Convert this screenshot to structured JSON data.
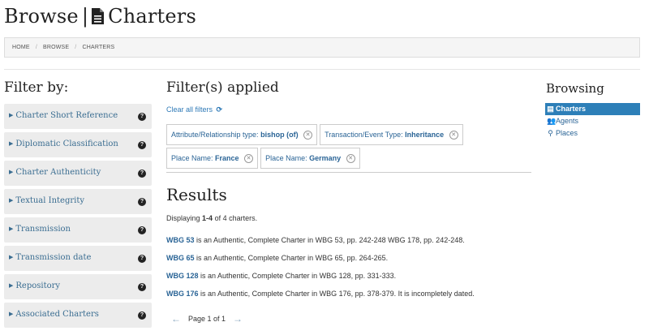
{
  "page": {
    "title_prefix": "Browse",
    "title_separator": "|",
    "title": "Charters"
  },
  "breadcrumb": [
    "HOME",
    "BROWSE",
    "CHARTERS"
  ],
  "filters": {
    "title": "Filter by:",
    "facets": [
      {
        "label": "Charter Short Reference"
      },
      {
        "label": "Diplomatic Classification"
      },
      {
        "label": "Charter Authenticity"
      },
      {
        "label": "Textual Integrity"
      },
      {
        "label": "Transmission"
      },
      {
        "label": "Transmission date"
      },
      {
        "label": "Repository"
      },
      {
        "label": "Associated Charters"
      }
    ],
    "help_glyph": "?"
  },
  "applied": {
    "title": "Filter(s) applied",
    "clear_label": "Clear all filters",
    "chips": [
      {
        "key": "Attribute/Relationship type:",
        "value": "bishop (of)"
      },
      {
        "key": "Transaction/Event Type:",
        "value": "Inheritance"
      },
      {
        "key": "Place Name:",
        "value": "France"
      },
      {
        "key": "Place Name:",
        "value": "Germany"
      }
    ]
  },
  "results": {
    "title": "Results",
    "displaying_prefix": "Displaying",
    "displaying_range": "1-4",
    "displaying_suffix": "of 4 charters.",
    "items": [
      {
        "ref": "WBG 53",
        "text": "is an Authentic, Complete Charter in WBG 53, pp. 242-248 WBG 178, pp. 242-248."
      },
      {
        "ref": "WBG 65",
        "text": "is an Authentic, Complete Charter in WBG 65, pp. 264-265."
      },
      {
        "ref": "WBG 128",
        "text": "is an Authentic, Complete Charter in WBG 128, pp. 331-333."
      },
      {
        "ref": "WBG 176",
        "text": "is an Authentic, Complete Charter in WBG 176, pp. 378-379. It is incompletely dated."
      }
    ]
  },
  "pagination": {
    "prev": "←",
    "label": "Page 1 of 1",
    "next": "→"
  },
  "browsing": {
    "title": "Browsing",
    "items": [
      {
        "label": "Charters",
        "icon": "document-icon",
        "active": true
      },
      {
        "label": "Agents",
        "icon": "users-icon",
        "active": false
      },
      {
        "label": "Places",
        "icon": "map-marker-icon",
        "active": false
      }
    ]
  },
  "colors": {
    "link": "#2a6496",
    "active_nav": "#2d7fb8",
    "facet_bg": "#ececec"
  }
}
